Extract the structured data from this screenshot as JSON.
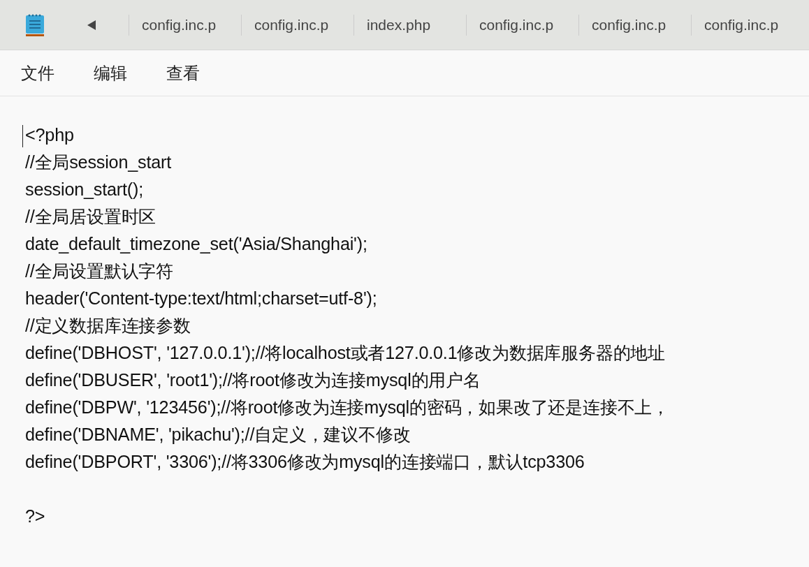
{
  "tabs": [
    {
      "label": "config.inc.p"
    },
    {
      "label": "config.inc.p"
    },
    {
      "label": "index.php"
    },
    {
      "label": "config.inc.p"
    },
    {
      "label": "config.inc.p"
    },
    {
      "label": "config.inc.p"
    }
  ],
  "menu": [
    "文件",
    "编辑",
    "查看"
  ],
  "editor": {
    "lines": [
      {
        "kind": "code",
        "text": "<?php"
      },
      {
        "kind": "code",
        "text": "//全局session_start"
      },
      {
        "kind": "code",
        "text": "session_start();"
      },
      {
        "kind": "code",
        "text": "//全局居设置时区"
      },
      {
        "kind": "code",
        "text": "date_default_timezone_set('Asia/Shanghai');"
      },
      {
        "kind": "code",
        "text": "//全局设置默认字符"
      },
      {
        "kind": "code",
        "text": "header('Content-type:text/html;charset=utf-8');"
      },
      {
        "kind": "code",
        "text": "//定义数据库连接参数"
      },
      {
        "kind": "code",
        "text": "define('DBHOST', '127.0.0.1');//将localhost或者127.0.0.1修改为数据库服务器的地址"
      },
      {
        "kind": "code",
        "text": "define('DBUSER', 'root1');//将root修改为连接mysql的用户名"
      },
      {
        "kind": "code",
        "text": "define('DBPW', '123456');//将root修改为连接mysql的密码，如果改了还是连接不上，"
      },
      {
        "kind": "code",
        "text": "define('DBNAME', 'pikachu');//自定义，建议不修改"
      },
      {
        "kind": "code",
        "text": "define('DBPORT', '3306');//将3306修改为mysql的连接端口，默认tcp3306"
      },
      {
        "kind": "blank"
      },
      {
        "kind": "code",
        "text": "?>"
      }
    ]
  }
}
